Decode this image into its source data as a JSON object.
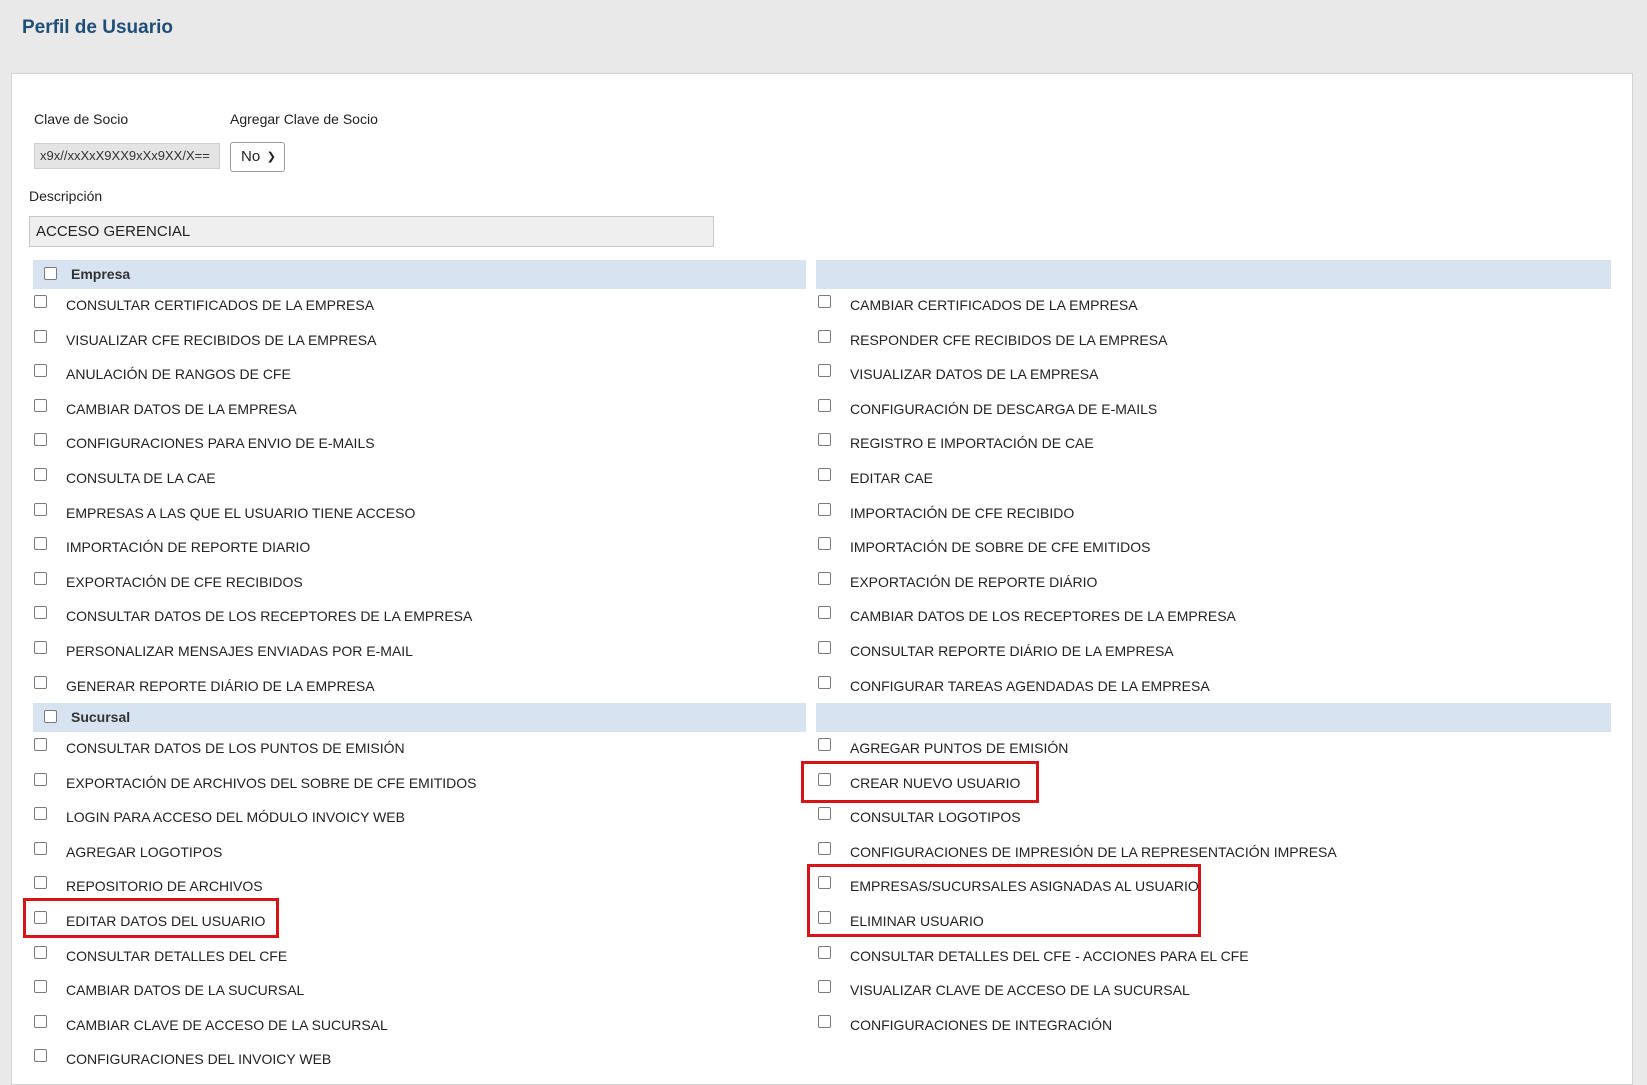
{
  "page": {
    "title": "Perfil de Usuario"
  },
  "form": {
    "clave_socio_label": "Clave de Socio",
    "clave_socio_value": "x9x//xxXxX9XX9xXx9XX/X==",
    "agregar_label": "Agregar Clave de Socio",
    "agregar_value": "No",
    "descripcion_label": "Descripción",
    "descripcion_value": "ACCESO GERENCIAL"
  },
  "sections": [
    {
      "title": "Empresa"
    },
    {
      "title": "Sucursal"
    }
  ],
  "empresa": {
    "left": [
      "CONSULTAR CERTIFICADOS DE LA EMPRESA",
      "VISUALIZAR CFE RECIBIDOS DE LA EMPRESA",
      "ANULACIÓN DE RANGOS DE CFE",
      "CAMBIAR DATOS DE LA EMPRESA",
      "CONFIGURACIONES PARA ENVIO DE E-MAILS",
      "CONSULTA DE LA CAE",
      "EMPRESAS A LAS QUE EL USUARIO TIENE ACCESO",
      "IMPORTACIÓN DE REPORTE DIARIO",
      "EXPORTACIÓN DE CFE RECIBIDOS",
      "CONSULTAR DATOS DE LOS RECEPTORES DE LA EMPRESA",
      "PERSONALIZAR MENSAJES ENVIADAS POR E-MAIL",
      "GENERAR REPORTE DIÁRIO DE LA EMPRESA"
    ],
    "right": [
      "CAMBIAR CERTIFICADOS DE LA EMPRESA",
      "RESPONDER CFE RECIBIDOS DE LA EMPRESA",
      "VISUALIZAR DATOS DE LA EMPRESA",
      "CONFIGURACIÓN DE DESCARGA DE E-MAILS",
      "REGISTRO E IMPORTACIÓN DE CAE",
      "EDITAR CAE",
      "IMPORTACIÓN DE CFE RECIBIDO",
      "IMPORTACIÓN DE SOBRE DE CFE EMITIDOS",
      "EXPORTACIÓN DE REPORTE DIÁRIO",
      "CAMBIAR DATOS DE LOS RECEPTORES DE LA EMPRESA",
      "CONSULTAR REPORTE DIÁRIO DE LA EMPRESA",
      "CONFIGURAR TAREAS AGENDADAS DE LA EMPRESA"
    ]
  },
  "sucursal": {
    "left": [
      "CONSULTAR DATOS DE LOS PUNTOS DE EMISIÓN",
      "EXPORTACIÓN DE ARCHIVOS DEL SOBRE DE CFE EMITIDOS",
      "LOGIN PARA ACCESO DEL MÓDULO INVOICY WEB",
      "AGREGAR LOGOTIPOS",
      "REPOSITORIO DE ARCHIVOS",
      "EDITAR DATOS DEL USUARIO",
      "CONSULTAR DETALLES DEL CFE",
      "CAMBIAR DATOS DE LA SUCURSAL",
      "CAMBIAR CLAVE DE ACCESO DE LA SUCURSAL",
      "CONFIGURACIONES DEL INVOICY WEB"
    ],
    "right": [
      "AGREGAR PUNTOS DE EMISIÓN",
      "CREAR NUEVO USUARIO",
      "CONSULTAR LOGOTIPOS",
      "CONFIGURACIONES DE IMPRESIÓN DE LA REPRESENTACIÓN IMPRESA",
      "EMPRESAS/SUCURSALES ASIGNADAS AL USUARIO",
      "ELIMINAR USUARIO",
      "CONSULTAR DETALLES DEL CFE - ACCIONES PARA EL CFE",
      "VISUALIZAR CLAVE DE ACCESO DE LA SUCURSAL",
      "CONFIGURACIONES DE INTEGRACIÓN"
    ]
  },
  "highlight_color": "#d7141a",
  "header_color": "#d7e3f1"
}
